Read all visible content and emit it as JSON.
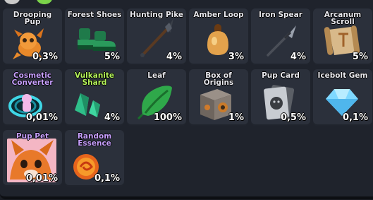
{
  "colors": {
    "tile_bg": "#2b303b",
    "name_default": "#e8e8ee",
    "name_purple": "#c7a0ff",
    "name_green": "#b4f25a"
  },
  "items": [
    {
      "name": "Drooping Pup",
      "chance": "0,3%",
      "icon": "drooping-pup-icon"
    },
    {
      "name": "Forest Shoes",
      "chance": "5%",
      "icon": "forest-shoes-icon"
    },
    {
      "name": "Hunting Pike",
      "chance": "4%",
      "icon": "hunting-pike-icon"
    },
    {
      "name": "Amber Loop",
      "chance": "3%",
      "icon": "amber-loop-icon"
    },
    {
      "name": "Iron Spear",
      "chance": "4%",
      "icon": "iron-spear-icon"
    },
    {
      "name": "Arcanum Scroll",
      "chance": "5%",
      "icon": "arcanum-scroll-icon"
    },
    {
      "name": "Cosmetic Converter",
      "chance": "0,01%",
      "icon": "cosmetic-converter-icon"
    },
    {
      "name": "Vulkanite Shard",
      "chance": "4%",
      "icon": "vulkanite-shard-icon"
    },
    {
      "name": "Leaf",
      "chance": "100%",
      "icon": "leaf-icon"
    },
    {
      "name": "Box of Origins",
      "chance": "1%",
      "icon": "box-of-origins-icon"
    },
    {
      "name": "Pup Card",
      "chance": "0,5%",
      "icon": "pup-card-icon"
    },
    {
      "name": "Icebolt Gem",
      "chance": "0,1%",
      "icon": "icebolt-gem-icon"
    },
    {
      "name": "Pup Pet",
      "chance": "0,01%",
      "icon": "pup-pet-icon"
    },
    {
      "name": "Random Essence",
      "chance": "0,1%",
      "icon": "random-essence-icon"
    }
  ]
}
